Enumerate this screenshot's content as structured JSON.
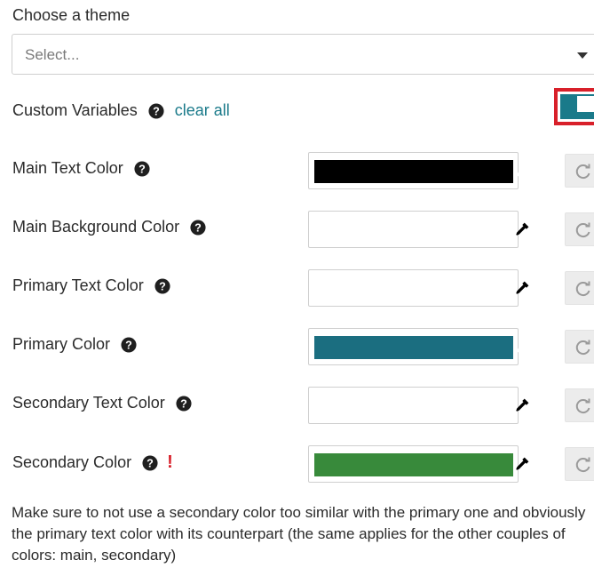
{
  "theme": {
    "title": "Choose a theme",
    "select_placeholder": "Select..."
  },
  "custom_variables": {
    "label": "Custom Variables",
    "clear_label": "clear all",
    "toggle_on": true,
    "accent_color": "#1a7a8a"
  },
  "colors": [
    {
      "label": "Main Text Color",
      "value": "#000000",
      "warning": false,
      "dropper_color": "#ffffff"
    },
    {
      "label": "Main Background Color",
      "value": "#ffffff",
      "warning": false,
      "dropper_color": "#000000"
    },
    {
      "label": "Primary Text Color",
      "value": "#ffffff",
      "warning": false,
      "dropper_color": "#000000"
    },
    {
      "label": "Primary Color",
      "value": "#1b6e80",
      "warning": false,
      "dropper_color": "#ffffff"
    },
    {
      "label": "Secondary Text Color",
      "value": "#ffffff",
      "warning": false,
      "dropper_color": "#000000"
    },
    {
      "label": "Secondary Color",
      "value": "#388a3b",
      "warning": true,
      "warning_text": "!",
      "dropper_color": "#000000"
    }
  ],
  "note": "Make sure to not use a secondary color too similar with the primary one and obviously the primary text color with its counterpart (the same applies for the other couples of colors: main, secondary)"
}
